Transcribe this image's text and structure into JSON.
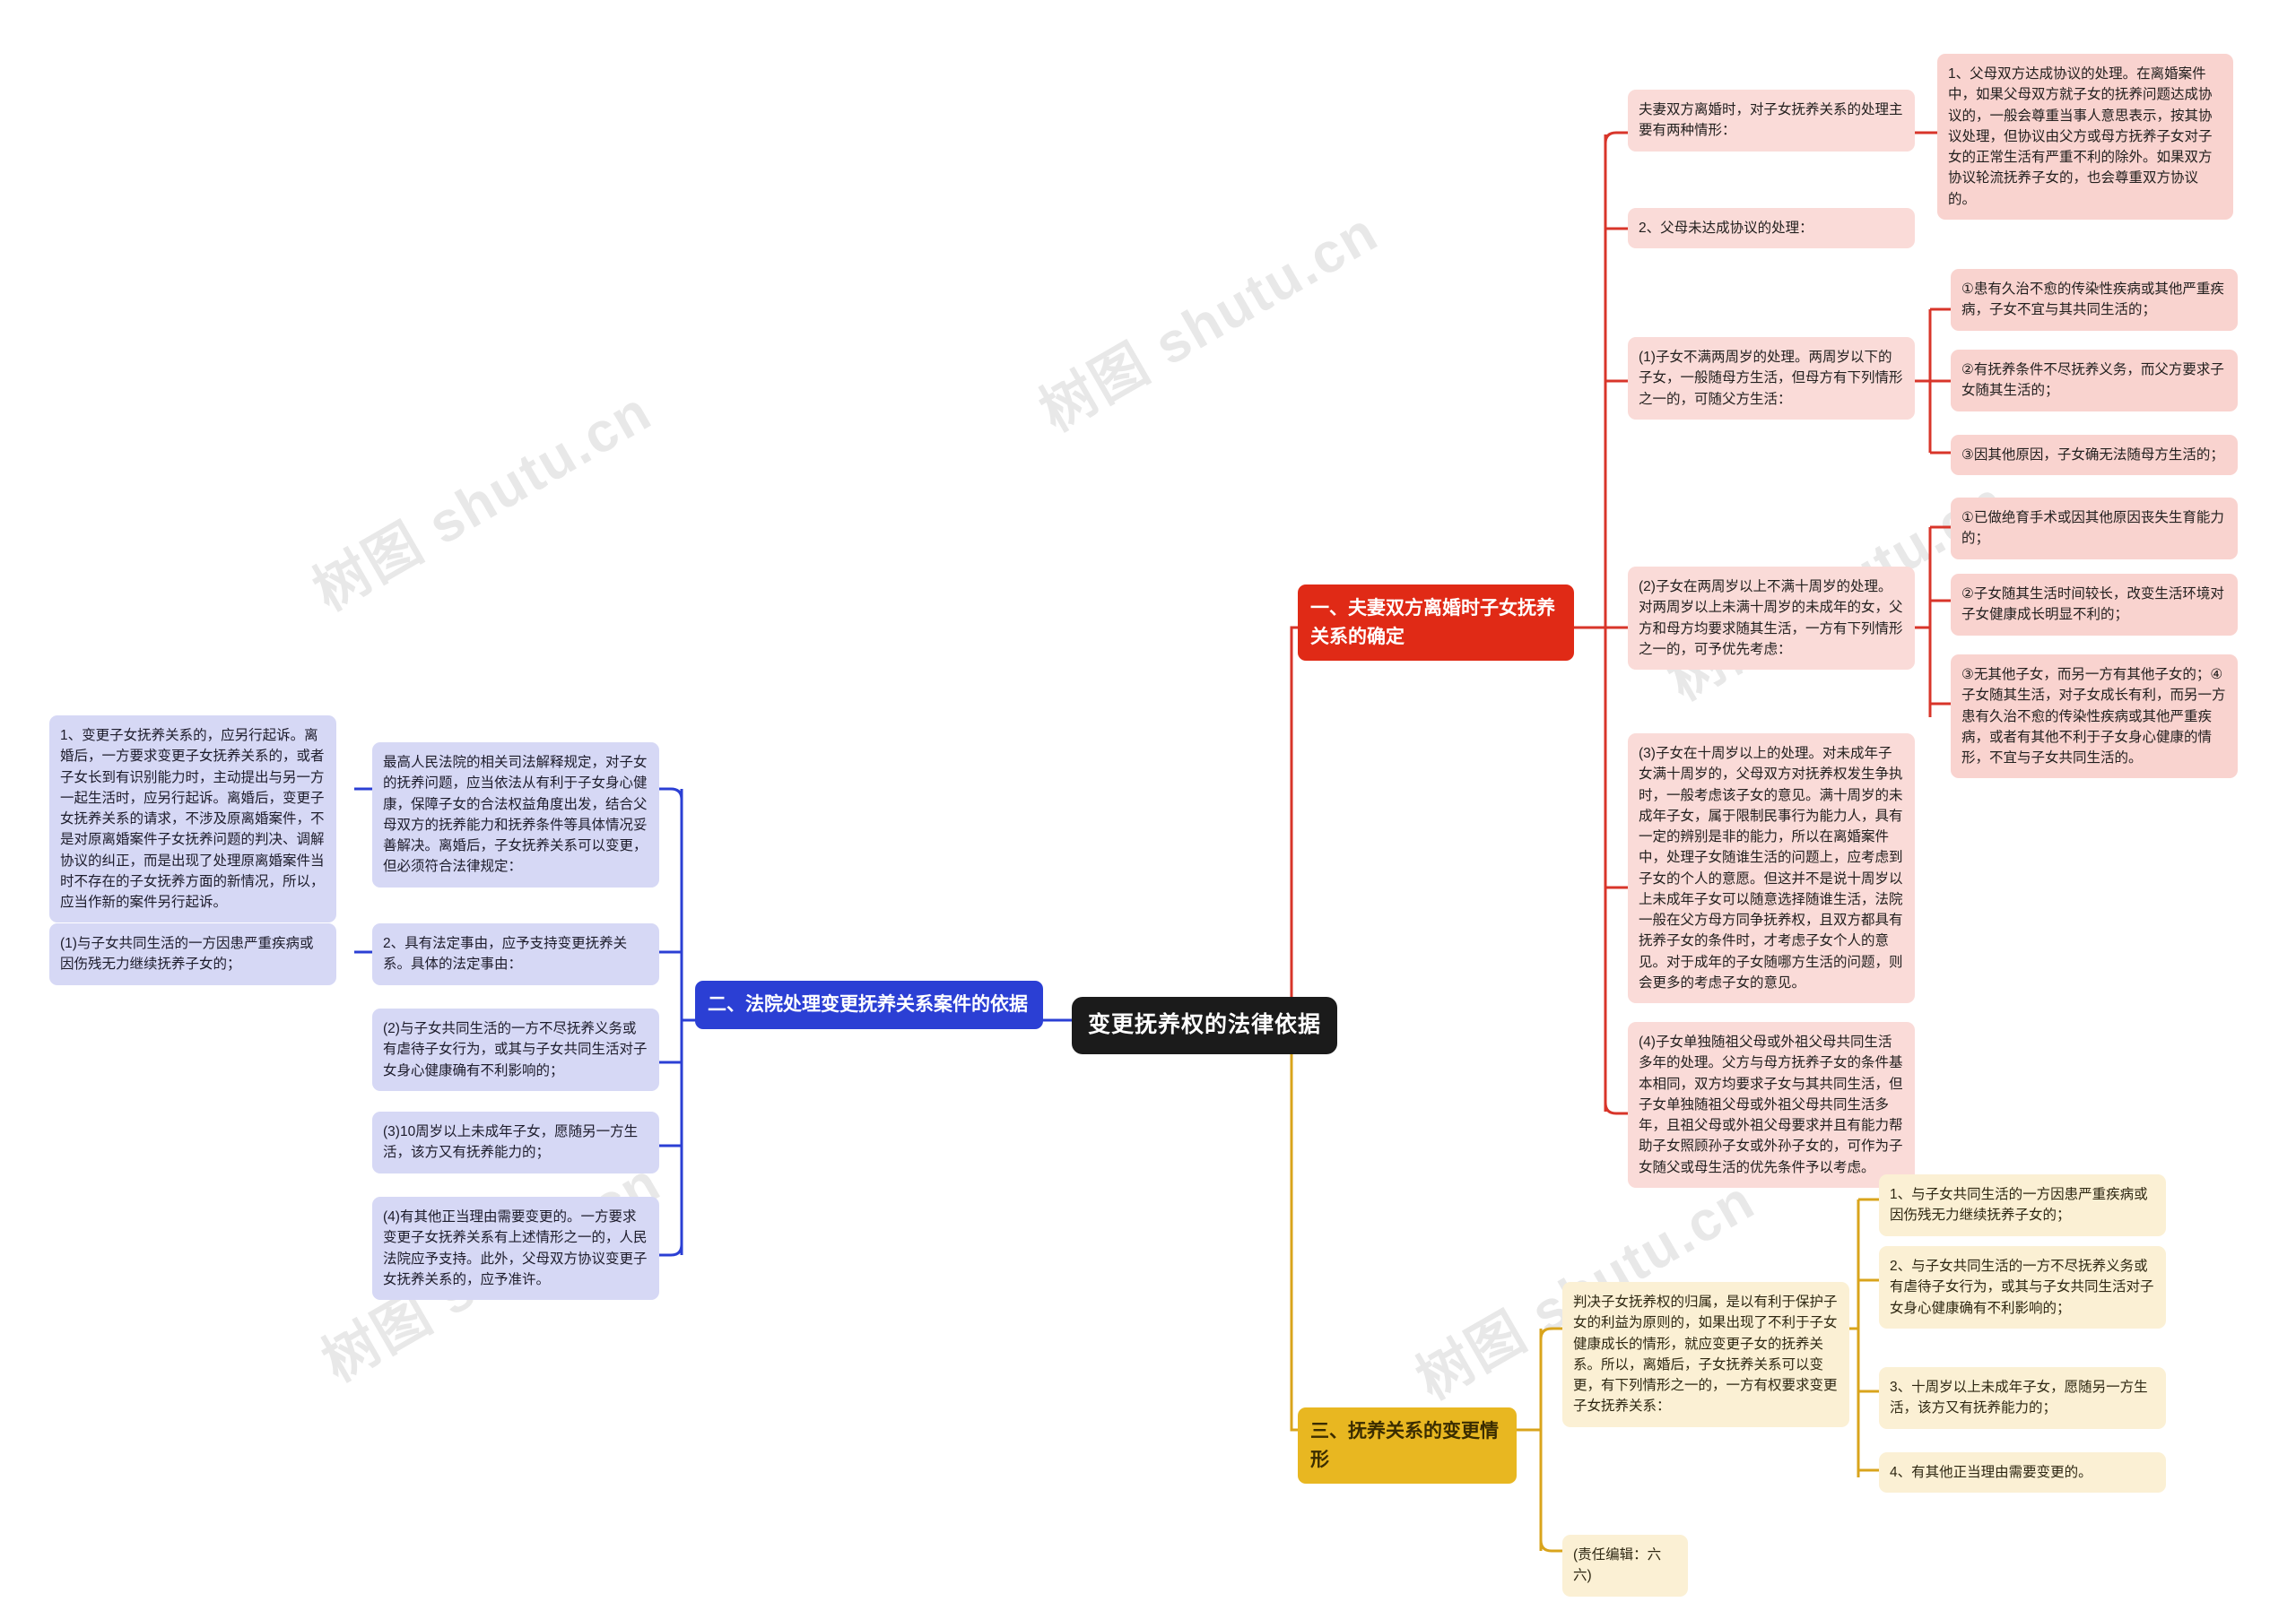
{
  "meta": {
    "watermark": "树图 shutu.cn"
  },
  "root": {
    "label": "变更抚养权的法律依据"
  },
  "branches": [
    {
      "id": "branch-1",
      "label": "一、夫妻双方离婚时子女抚养关系的确定",
      "color": "#e02a16"
    },
    {
      "id": "branch-2",
      "label": "二、法院处理变更抚养关系案件的依据",
      "color": "#2b3fd4"
    },
    {
      "id": "branch-3",
      "label": "三、抚养关系的变更情形",
      "color": "#e8b721"
    }
  ],
  "b1": {
    "n1": "夫妻双方离婚时，对子女抚养关系的处理主要有两种情形：",
    "n1c1": "1、父母双方达成协议的处理。在离婚案件中，如果父母双方就子女的抚养问题达成协议的，一般会尊重当事人意思表示，按其协议处理，但协议由父方或母方抚养子女对子女的正常生活有严重不利的除外。如果双方协议轮流抚养子女的，也会尊重双方协议的。",
    "n2": "2、父母未达成协议的处理：",
    "n2c1": "(1)子女不满两周岁的处理。两周岁以下的子女，一般随母方生活，但母方有下列情形之一的，可随父方生活：",
    "n2c1a": "①患有久治不愈的传染性疾病或其他严重疾病，子女不宜与其共同生活的；",
    "n2c1b": "②有抚养条件不尽抚养义务，而父方要求子女随其生活的；",
    "n2c1c": "③因其他原因，子女确无法随母方生活的；",
    "n2c2": "(2)子女在两周岁以上不满十周岁的处理。对两周岁以上未满十周岁的未成年的女，父方和母方均要求随其生活，一方有下列情形之一的，可予优先考虑：",
    "n2c2a": "①已做绝育手术或因其他原因丧失生育能力的；",
    "n2c2b": "②子女随其生活时间较长，改变生活环境对子女健康成长明显不利的；",
    "n2c2c": "③无其他子女，而另一方有其他子女的；④子女随其生活，对子女成长有利，而另一方患有久治不愈的传染性疾病或其他严重疾病，或者有其他不利于子女身心健康的情形，不宜与子女共同生活的。",
    "n2c3": "(3)子女在十周岁以上的处理。对未成年子女满十周岁的，父母双方对抚养权发生争执时，一般考虑该子女的意见。满十周岁的未成年子女，属于限制民事行为能力人，具有一定的辨别是非的能力，所以在离婚案件中，处理子女随谁生活的问题上，应考虑到子女的个人的意愿。但这并不是说十周岁以上未成年子女可以随意选择随谁生活，法院一般在父方母方同争抚养权，且双方都具有抚养子女的条件时，才考虑子女个人的意见。对于成年的子女随哪方生活的问题，则会更多的考虑子女的意见。",
    "n2c4": "(4)子女单独随祖父母或外祖父母共同生活多年的处理。父方与母方抚养子女的条件基本相同，双方均要求子女与其共同生活，但子女单独随祖父母或外祖父母共同生活多年，且祖父母或外祖父母要求并且有能力帮助子女照顾孙子女或外孙子女的，可作为子女随父或母生活的优先条件予以考虑。"
  },
  "b2": {
    "n1": "最高人民法院的相关司法解释规定，对子女的抚养问题，应当依法从有利于子女身心健康，保障子女的合法权益角度出发，结合父母双方的抚养能力和抚养条件等具体情况妥善解决。离婚后，子女抚养关系可以变更，但必须符合法律规定：",
    "n1a": "1、变更子女抚养关系的，应另行起诉。离婚后，一方要求变更子女抚养关系的，或者子女长到有识别能力时，主动提出与另一方一起生活时，应另行起诉。离婚后，变更子女抚养关系的请求，不涉及原离婚案件，不是对原离婚案件子女抚养问题的判决、调解协议的纠正，而是出现了处理原离婚案件当时不存在的子女抚养方面的新情况，所以，应当作新的案件另行起诉。",
    "n2": "2、具有法定事由，应予支持变更抚养关系。具体的法定事由：",
    "n2a": "(1)与子女共同生活的一方因患严重疾病或因伤残无力继续抚养子女的；",
    "n2b": "(2)与子女共同生活的一方不尽抚养义务或有虐待子女行为，或其与子女共同生活对子女身心健康确有不利影响的；",
    "n2c": "(3)10周岁以上未成年子女，愿随另一方生活，该方又有抚养能力的；",
    "n2d": "(4)有其他正当理由需要变更的。一方要求变更子女抚养关系有上述情形之一的，人民法院应予支持。此外，父母双方协议变更子女抚养关系的，应予准许。"
  },
  "b3": {
    "n1": "判决子女抚养权的归属，是以有利于保护子女的利益为原则的，如果出现了不利于子女健康成长的情形，就应变更子女的抚养关系。所以，离婚后，子女抚养关系可以变更，有下列情形之一的，一方有权要求变更子女抚养关系：",
    "n1a": "1、与子女共同生活的一方因患严重疾病或因伤残无力继续抚养子女的；",
    "n1b": "2、与子女共同生活的一方不尽抚养义务或有虐待子女行为，或其与子女共同生活对子女身心健康确有不利影响的；",
    "n1c": "3、十周岁以上未成年子女，愿随另一方生活，该方又有抚养能力的；",
    "n1d": "4、有其他正当理由需要变更的。",
    "editor": "(责任编辑：六六)"
  }
}
